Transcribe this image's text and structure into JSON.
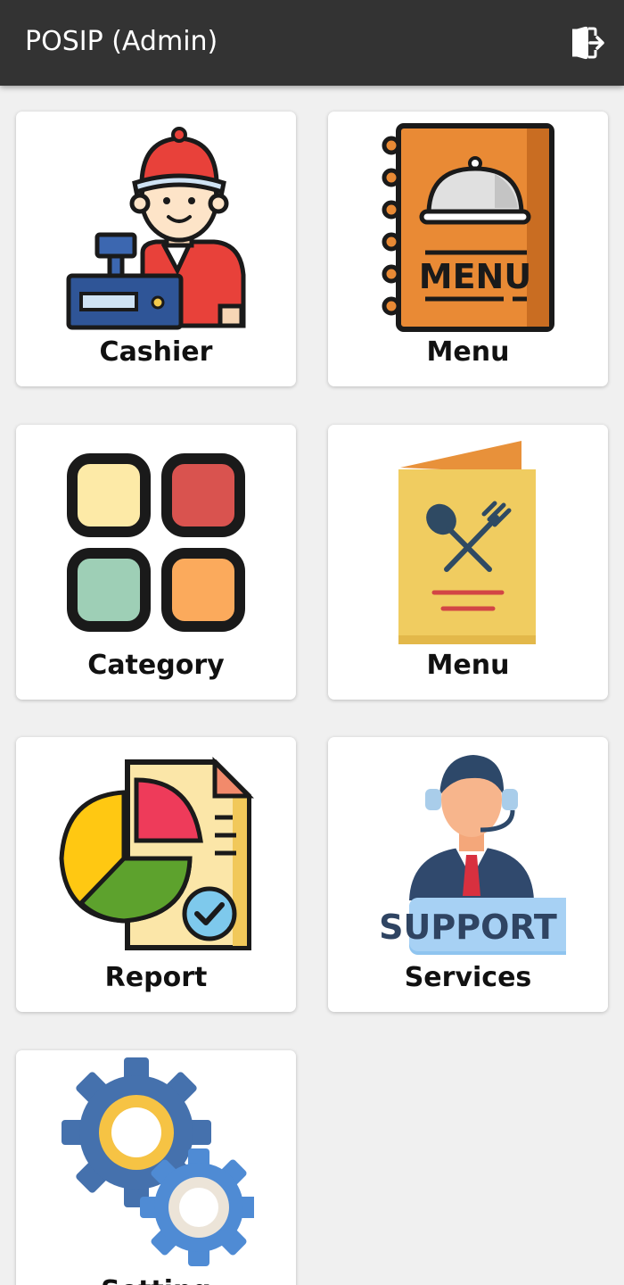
{
  "appbar": {
    "title": "POSIP (Admin)",
    "logout_icon": "logout-icon"
  },
  "tiles": [
    {
      "label": "Cashier",
      "icon": "cashier-icon"
    },
    {
      "label": "Menu",
      "icon": "menu-book-icon"
    },
    {
      "label": "Category",
      "icon": "category-grid-icon"
    },
    {
      "label": "Menu",
      "icon": "menu-card-icon"
    },
    {
      "label": "Report",
      "icon": "report-chart-icon"
    },
    {
      "label": "Services",
      "icon": "support-agent-icon"
    },
    {
      "label": "Setting",
      "icon": "gears-icon"
    }
  ]
}
